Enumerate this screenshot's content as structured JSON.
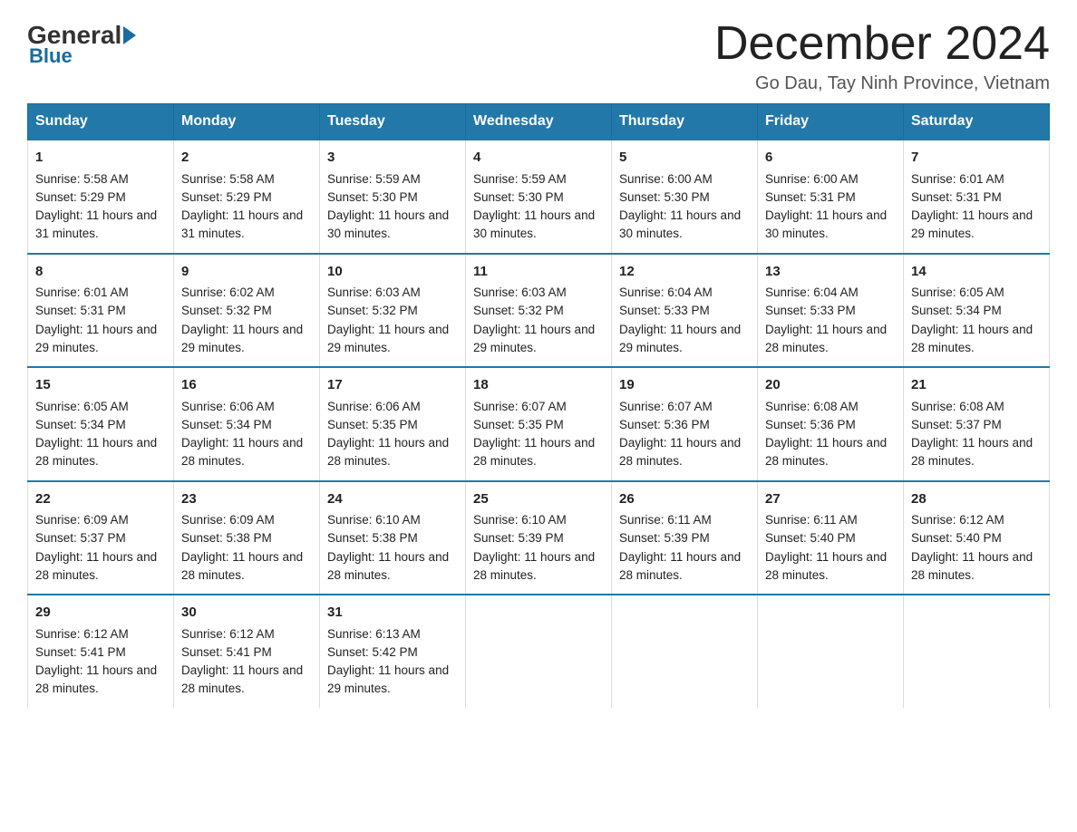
{
  "header": {
    "logo": {
      "general": "General",
      "blue": "Blue"
    },
    "title": "December 2024",
    "location": "Go Dau, Tay Ninh Province, Vietnam"
  },
  "weekdays": [
    "Sunday",
    "Monday",
    "Tuesday",
    "Wednesday",
    "Thursday",
    "Friday",
    "Saturday"
  ],
  "weeks": [
    [
      {
        "day": "1",
        "sunrise": "5:58 AM",
        "sunset": "5:29 PM",
        "daylight": "11 hours and 31 minutes."
      },
      {
        "day": "2",
        "sunrise": "5:58 AM",
        "sunset": "5:29 PM",
        "daylight": "11 hours and 31 minutes."
      },
      {
        "day": "3",
        "sunrise": "5:59 AM",
        "sunset": "5:30 PM",
        "daylight": "11 hours and 30 minutes."
      },
      {
        "day": "4",
        "sunrise": "5:59 AM",
        "sunset": "5:30 PM",
        "daylight": "11 hours and 30 minutes."
      },
      {
        "day": "5",
        "sunrise": "6:00 AM",
        "sunset": "5:30 PM",
        "daylight": "11 hours and 30 minutes."
      },
      {
        "day": "6",
        "sunrise": "6:00 AM",
        "sunset": "5:31 PM",
        "daylight": "11 hours and 30 minutes."
      },
      {
        "day": "7",
        "sunrise": "6:01 AM",
        "sunset": "5:31 PM",
        "daylight": "11 hours and 29 minutes."
      }
    ],
    [
      {
        "day": "8",
        "sunrise": "6:01 AM",
        "sunset": "5:31 PM",
        "daylight": "11 hours and 29 minutes."
      },
      {
        "day": "9",
        "sunrise": "6:02 AM",
        "sunset": "5:32 PM",
        "daylight": "11 hours and 29 minutes."
      },
      {
        "day": "10",
        "sunrise": "6:03 AM",
        "sunset": "5:32 PM",
        "daylight": "11 hours and 29 minutes."
      },
      {
        "day": "11",
        "sunrise": "6:03 AM",
        "sunset": "5:32 PM",
        "daylight": "11 hours and 29 minutes."
      },
      {
        "day": "12",
        "sunrise": "6:04 AM",
        "sunset": "5:33 PM",
        "daylight": "11 hours and 29 minutes."
      },
      {
        "day": "13",
        "sunrise": "6:04 AM",
        "sunset": "5:33 PM",
        "daylight": "11 hours and 28 minutes."
      },
      {
        "day": "14",
        "sunrise": "6:05 AM",
        "sunset": "5:34 PM",
        "daylight": "11 hours and 28 minutes."
      }
    ],
    [
      {
        "day": "15",
        "sunrise": "6:05 AM",
        "sunset": "5:34 PM",
        "daylight": "11 hours and 28 minutes."
      },
      {
        "day": "16",
        "sunrise": "6:06 AM",
        "sunset": "5:34 PM",
        "daylight": "11 hours and 28 minutes."
      },
      {
        "day": "17",
        "sunrise": "6:06 AM",
        "sunset": "5:35 PM",
        "daylight": "11 hours and 28 minutes."
      },
      {
        "day": "18",
        "sunrise": "6:07 AM",
        "sunset": "5:35 PM",
        "daylight": "11 hours and 28 minutes."
      },
      {
        "day": "19",
        "sunrise": "6:07 AM",
        "sunset": "5:36 PM",
        "daylight": "11 hours and 28 minutes."
      },
      {
        "day": "20",
        "sunrise": "6:08 AM",
        "sunset": "5:36 PM",
        "daylight": "11 hours and 28 minutes."
      },
      {
        "day": "21",
        "sunrise": "6:08 AM",
        "sunset": "5:37 PM",
        "daylight": "11 hours and 28 minutes."
      }
    ],
    [
      {
        "day": "22",
        "sunrise": "6:09 AM",
        "sunset": "5:37 PM",
        "daylight": "11 hours and 28 minutes."
      },
      {
        "day": "23",
        "sunrise": "6:09 AM",
        "sunset": "5:38 PM",
        "daylight": "11 hours and 28 minutes."
      },
      {
        "day": "24",
        "sunrise": "6:10 AM",
        "sunset": "5:38 PM",
        "daylight": "11 hours and 28 minutes."
      },
      {
        "day": "25",
        "sunrise": "6:10 AM",
        "sunset": "5:39 PM",
        "daylight": "11 hours and 28 minutes."
      },
      {
        "day": "26",
        "sunrise": "6:11 AM",
        "sunset": "5:39 PM",
        "daylight": "11 hours and 28 minutes."
      },
      {
        "day": "27",
        "sunrise": "6:11 AM",
        "sunset": "5:40 PM",
        "daylight": "11 hours and 28 minutes."
      },
      {
        "day": "28",
        "sunrise": "6:12 AM",
        "sunset": "5:40 PM",
        "daylight": "11 hours and 28 minutes."
      }
    ],
    [
      {
        "day": "29",
        "sunrise": "6:12 AM",
        "sunset": "5:41 PM",
        "daylight": "11 hours and 28 minutes."
      },
      {
        "day": "30",
        "sunrise": "6:12 AM",
        "sunset": "5:41 PM",
        "daylight": "11 hours and 28 minutes."
      },
      {
        "day": "31",
        "sunrise": "6:13 AM",
        "sunset": "5:42 PM",
        "daylight": "11 hours and 29 minutes."
      },
      null,
      null,
      null,
      null
    ]
  ],
  "labels": {
    "sunrise": "Sunrise:",
    "sunset": "Sunset:",
    "daylight": "Daylight:"
  }
}
